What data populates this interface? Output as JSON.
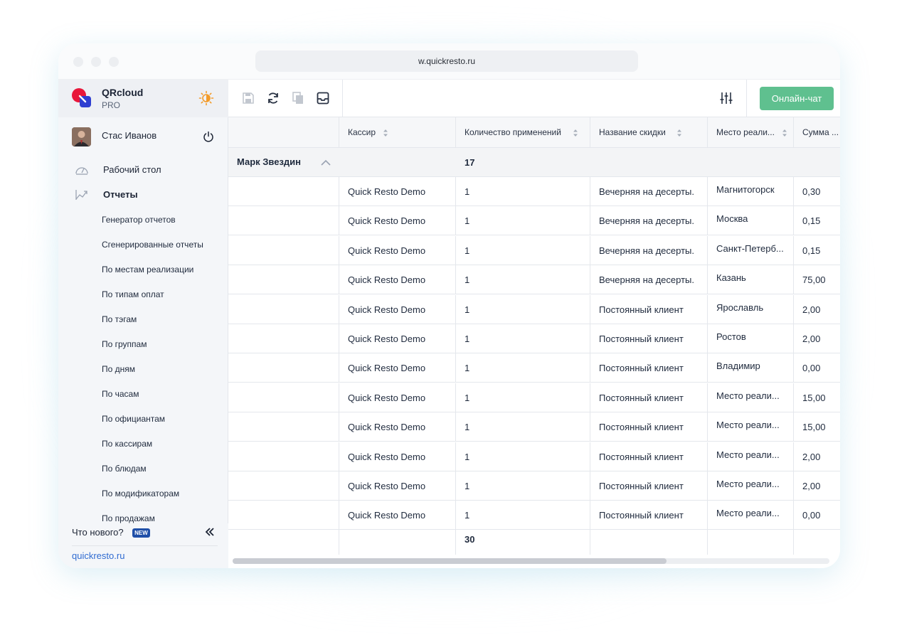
{
  "browser": {
    "url": "w.quickresto.ru"
  },
  "brand": {
    "name": "QRcloud",
    "tier": "PRO"
  },
  "user": {
    "name": "Стас Иванов"
  },
  "nav": {
    "desktop": "Рабочий стол",
    "reports": "Отчеты",
    "sub": [
      "Генератор отчетов",
      "Сгенерированные отчеты",
      "По местам реализации",
      "По типам оплат",
      "По тэгам",
      "По группам",
      "По дням",
      "По часам",
      "По официантам",
      "По кассирам",
      "По блюдам",
      "По модификаторам",
      "По продажам"
    ]
  },
  "footer": {
    "whats_new": "Что нового?",
    "badge": "NEW",
    "site": "quickresto.ru"
  },
  "toolbar": {
    "chat": "Онлайн-чат"
  },
  "table": {
    "columns": [
      "Кассир",
      "Количество применений",
      "Название скидки",
      "Место реали...",
      "Сумма ..."
    ],
    "group": {
      "name": "Марк Звездин",
      "count": "17"
    },
    "rows": [
      [
        "Quick Resto Demo",
        "1",
        "Вечерняя на десерты.",
        "Магнитогорск",
        "0,30"
      ],
      [
        "Quick Resto Demo",
        "1",
        "Вечерняя на десерты.",
        "Москва",
        "0,15"
      ],
      [
        "Quick Resto Demo",
        "1",
        "Вечерняя на десерты.",
        "Санкт-Петерб...",
        "0,15"
      ],
      [
        "Quick Resto Demo",
        "1",
        "Вечерняя на десерты.",
        "Казань",
        "75,00"
      ],
      [
        "Quick Resto Demo",
        "1",
        "Постоянный клиент",
        "Ярославль",
        "2,00"
      ],
      [
        "Quick Resto Demo",
        "1",
        "Постоянный клиент",
        "Ростов",
        "2,00"
      ],
      [
        "Quick Resto Demo",
        "1",
        "Постоянный клиент",
        "Владимир",
        "0,00"
      ],
      [
        "Quick Resto Demo",
        "1",
        "Постоянный клиент",
        "Место реали...",
        "15,00"
      ],
      [
        "Quick Resto Demo",
        "1",
        "Постоянный клиент",
        "Место реали...",
        "15,00"
      ],
      [
        "Quick Resto Demo",
        "1",
        "Постоянный клиент",
        "Место реали...",
        "2,00"
      ],
      [
        "Quick Resto Demo",
        "1",
        "Постоянный клиент",
        "Место реали...",
        "2,00"
      ],
      [
        "Quick Resto Demo",
        "1",
        "Постоянный клиент",
        "Место реали...",
        "0,00"
      ]
    ],
    "total": "30"
  },
  "colors": {
    "accent_green": "#5fc08f",
    "brand_red": "#e8173a",
    "brand_blue": "#2f3fd1",
    "link": "#2f6bd1",
    "badge": "#1f4fa8"
  }
}
